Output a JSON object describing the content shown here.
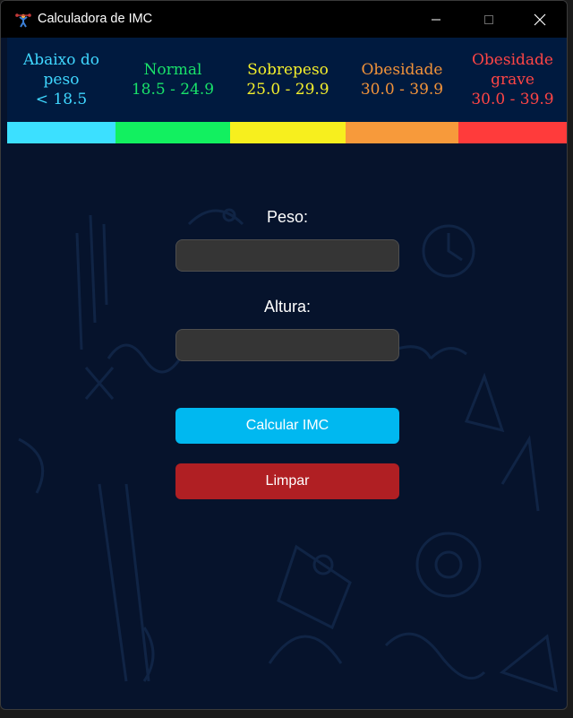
{
  "window": {
    "title": "Calculadora de IMC"
  },
  "categories": [
    {
      "name": "Abaixo do peso",
      "range": "< 18.5",
      "color": "#3fd7ff",
      "bar_color": "#3ce0ff"
    },
    {
      "name": "Normal",
      "range": "18.5 - 24.9",
      "color": "#19e26a",
      "bar_color": "#12f060"
    },
    {
      "name": "Sobrepeso",
      "range": "25.0 - 29.9",
      "color": "#f4ef2c",
      "bar_color": "#f7ef1e"
    },
    {
      "name": "Obesidade",
      "range": "30.0 - 39.9",
      "color": "#f3943a",
      "bar_color": "#f79a3b"
    },
    {
      "name": "Obesidade grave",
      "range": "30.0 - 39.9",
      "color": "#ff4545",
      "bar_color": "#ff3b3b"
    }
  ],
  "form": {
    "weight_label": "Peso:",
    "weight_value": "",
    "height_label": "Altura:",
    "height_value": "",
    "calculate_label": "Calcular IMC",
    "clear_label": "Limpar"
  }
}
